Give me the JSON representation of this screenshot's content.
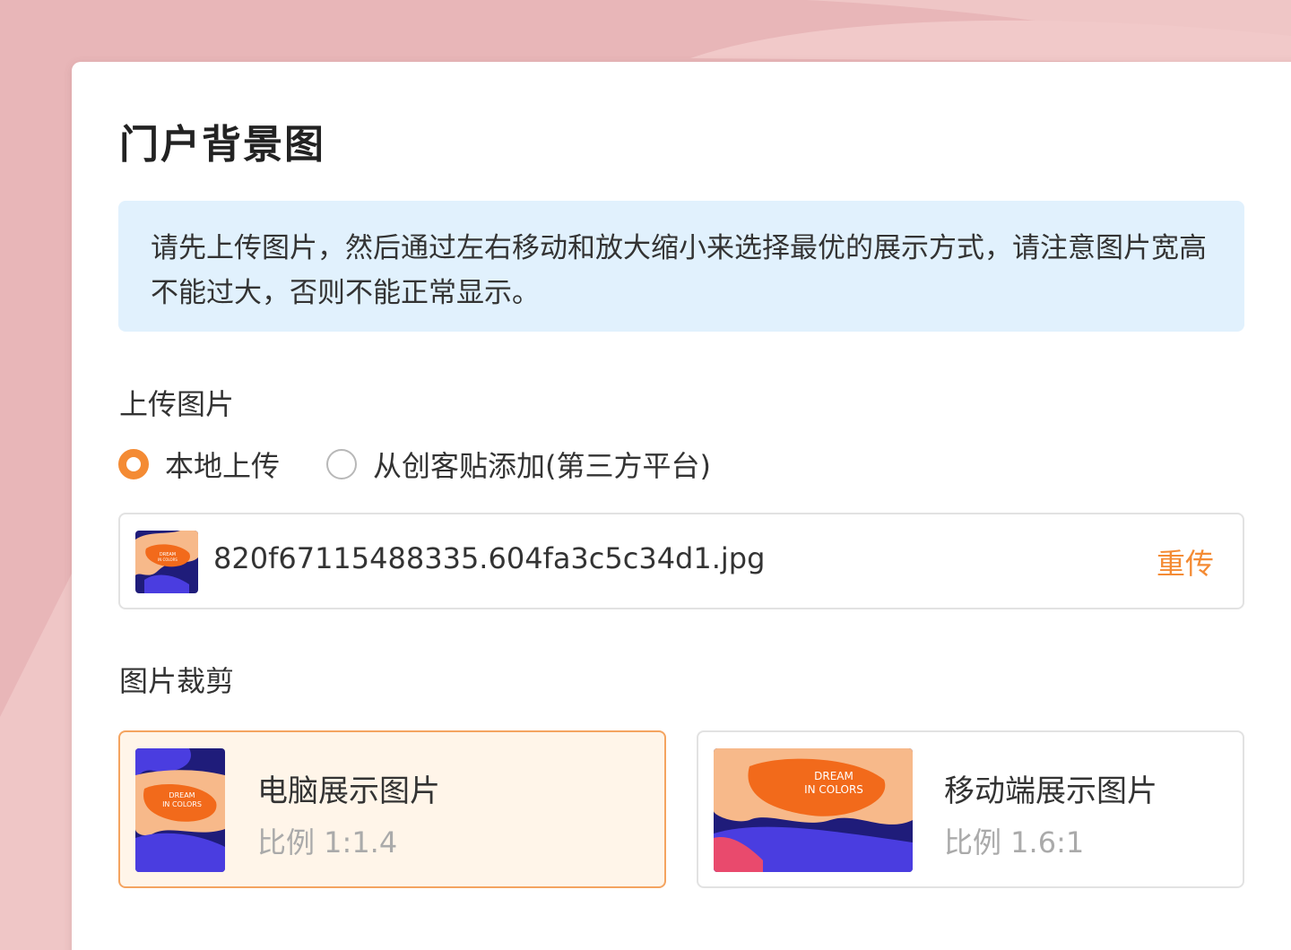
{
  "page": {
    "title": "门户背景图",
    "notice": "请先上传图片，然后通过左右移动和放大缩小来选择最优的展示方式，请注意图片宽高不能过大，否则不能正常显示。"
  },
  "upload": {
    "label": "上传图片",
    "options": [
      {
        "label": "本地上传",
        "checked": true
      },
      {
        "label": "从创客贴添加(第三方平台)",
        "checked": false
      }
    ],
    "file": {
      "name": "820f67115488335.604fa3c5c34d1.jpg",
      "reupload_label": "重传",
      "thumb_text_line1": "DREAM",
      "thumb_text_line2": "IN COLORS"
    }
  },
  "crop": {
    "label": "图片裁剪",
    "cards": [
      {
        "title": "电脑展示图片",
        "ratio": "比例 1:1.4",
        "selected": true
      },
      {
        "title": "移动端展示图片",
        "ratio": "比例 1.6:1",
        "selected": false
      }
    ]
  },
  "colors": {
    "accent": "#f48b34",
    "notice_bg": "#e1f1fd",
    "background": "#e8b6b8"
  }
}
